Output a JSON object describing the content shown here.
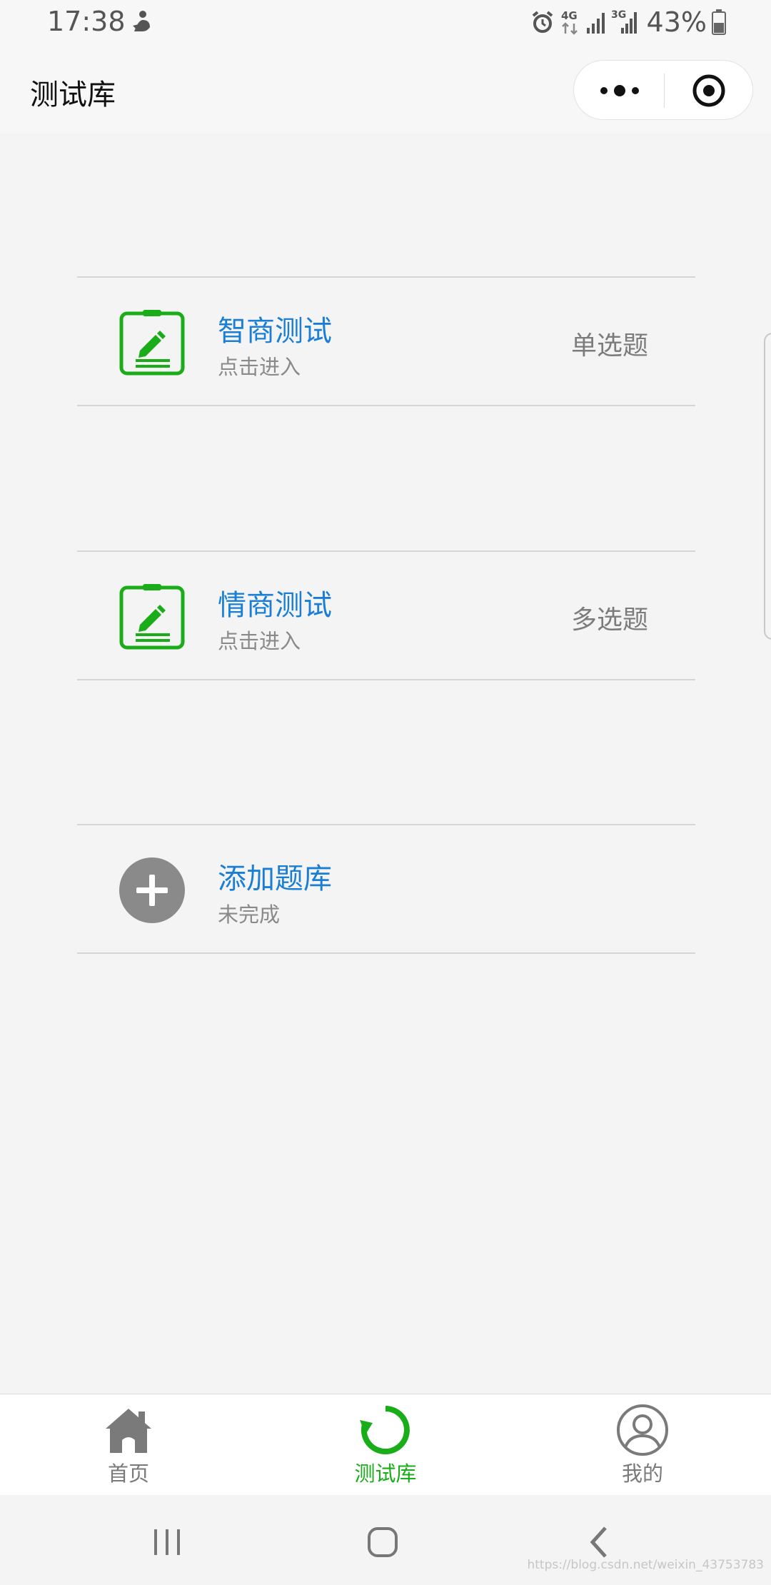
{
  "status_bar": {
    "time": "17:38",
    "battery": "43%",
    "icons": [
      "app-notification-icon",
      "alarm-icon",
      "4g-data-icon",
      "signal-icon",
      "3g-signal-icon",
      "battery-icon"
    ]
  },
  "header": {
    "title": "测试库",
    "capsule": {
      "more_icon": "more-dots-icon",
      "close_icon": "target-circle-icon"
    }
  },
  "cards": [
    {
      "icon": "clipboard-edit-icon",
      "title": "智商测试",
      "subtitle": "点击进入",
      "tag": "单选题"
    },
    {
      "icon": "clipboard-edit-icon",
      "title": "情商测试",
      "subtitle": "点击进入",
      "tag": "多选题"
    },
    {
      "icon": "plus-circle-icon",
      "title": "添加题库",
      "subtitle": "未完成",
      "tag": ""
    }
  ],
  "tabbar": {
    "items": [
      {
        "label": "首页",
        "icon": "home-icon",
        "active": false
      },
      {
        "label": "测试库",
        "icon": "refresh-icon",
        "active": true
      },
      {
        "label": "我的",
        "icon": "user-icon",
        "active": false
      }
    ]
  },
  "colors": {
    "accent_green": "#19ad19",
    "title_blue": "#1a7fd4",
    "background": "#f4f4f4"
  },
  "watermark": "https://blog.csdn.net/weixin_43753783"
}
